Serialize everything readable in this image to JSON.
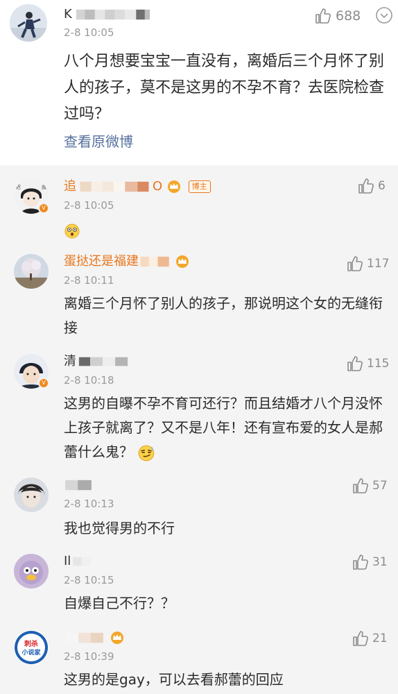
{
  "main_comment": {
    "user_name": "K",
    "time": "2-8 10:05",
    "likes": "688",
    "text": "八个月想要宝宝一直没有，离婚后三个月怀了别人的孩子，莫不是这男的不孕不育？去医院检查过吗？",
    "view_original": "查看原微博"
  },
  "replies": [
    {
      "name": "追",
      "name_tail": "O",
      "badge": "博主",
      "time": "2-8 10:05",
      "likes": "6",
      "text": ""
    },
    {
      "name": "蛋挞还是福建",
      "time": "2-8 10:11",
      "likes": "117",
      "text": "离婚三个月怀了别人的孩子，那说明这个女的无缝衔接"
    },
    {
      "name": "清",
      "time": "2-8 10:18",
      "likes": "115",
      "text": "这男的自曝不孕不育可还行？而且结婚才八个月没怀上孩子就离了？又不是八年！还有宣布爱的女人是郝蕾什么鬼？"
    },
    {
      "name": "",
      "time": "2-8 10:13",
      "likes": "57",
      "text": "我也觉得男的不行"
    },
    {
      "name": "Il",
      "time": "2-8 10:15",
      "likes": "31",
      "text": "自爆自己不行？？"
    },
    {
      "name": "",
      "time": "2-8 10:39",
      "likes": "21",
      "text": "这男的是gay，可以去看郝蕾的回应"
    }
  ],
  "avatar_texts": {
    "reply6": [
      "刺杀",
      "小说家"
    ]
  },
  "colors": {
    "name_orange": "#e8771e",
    "link_blue": "#56709d",
    "reply_bg": "#f4f4f4",
    "vip_badge": "#f08a1c"
  },
  "icons": [
    "thumb-up-icon",
    "chevron-down-circle-icon",
    "crown-icon",
    "dizzy-face-emoji",
    "smirk-face-emoji"
  ]
}
